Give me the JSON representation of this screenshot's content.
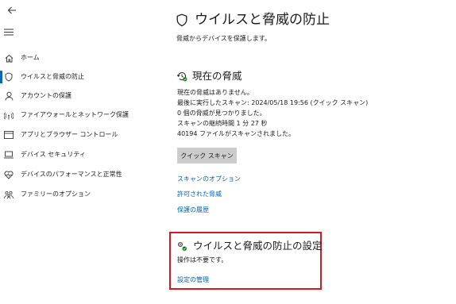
{
  "sidebar": {
    "items": [
      {
        "label": "ホーム",
        "icon": "home-icon"
      },
      {
        "label": "ウイルスと脅威の防止",
        "icon": "shield-icon",
        "active": true
      },
      {
        "label": "アカウントの保護",
        "icon": "person-icon"
      },
      {
        "label": "ファイアウォールとネットワーク保護",
        "icon": "wifi-icon"
      },
      {
        "label": "アプリとブラウザー コントロール",
        "icon": "app-browser-icon"
      },
      {
        "label": "デバイス セキュリティ",
        "icon": "laptop-icon"
      },
      {
        "label": "デバイスのパフォーマンスと正常性",
        "icon": "heart-icon"
      },
      {
        "label": "ファミリーのオプション",
        "icon": "family-icon"
      }
    ]
  },
  "main": {
    "title": "ウイルスと脅威の防止",
    "subtitle": "脅威からデバイスを保護します。",
    "current_threats": {
      "title": "現在の脅威",
      "lines": [
        "現在の脅威はありません。",
        "最後に実行したスキャン: 2024/05/18 19:56 (クイック スキャン)",
        "0 個の脅威が見つかりました。",
        "スキャンの継続時間 1 分 27 秒",
        "40194 ファイルがスキャンされました。"
      ],
      "quick_scan_label": "クイック スキャン",
      "links": [
        "スキャンのオプション",
        "許可された脅威",
        "保護の履歴"
      ]
    },
    "settings": {
      "title": "ウイルスと脅威の防止の設定",
      "subtitle": "操作は不要です。",
      "manage_link": "設定の管理"
    }
  },
  "colors": {
    "accent": "#0067c0",
    "link": "#0063b1",
    "highlight_border": "#e0141e",
    "button_bg": "#cccccc",
    "status_ok": "#107c10"
  }
}
